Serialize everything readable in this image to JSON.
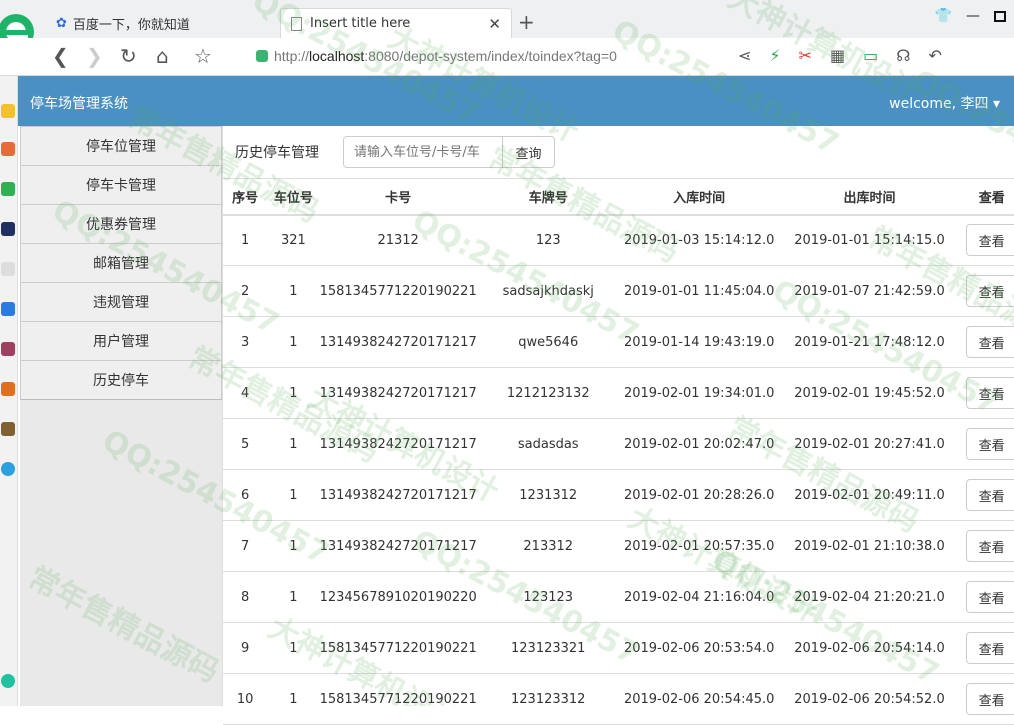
{
  "browser": {
    "tab1_title": "百度一下，你就知道",
    "tab2_title": "Insert title here",
    "url_prefix": "http://",
    "url_host": "localhost",
    "url_rest": ":8080/depot-system/index/toindex?tag=0"
  },
  "app": {
    "title": "停车场管理系统",
    "welcome": "welcome, 李四 ▾"
  },
  "menu": [
    {
      "label": "停车位管理"
    },
    {
      "label": "停车卡管理"
    },
    {
      "label": "优惠券管理"
    },
    {
      "label": "邮箱管理"
    },
    {
      "label": "违规管理"
    },
    {
      "label": "用户管理"
    },
    {
      "label": "历史停车"
    }
  ],
  "main": {
    "section_label": "历史停车管理",
    "search_placeholder": "请输入车位号/卡号/车",
    "search_button": "查询",
    "columns": [
      "序号",
      "车位号",
      "卡号",
      "车牌号",
      "入库时间",
      "出库时间",
      "查看"
    ],
    "view_label": "查看",
    "rows": [
      {
        "no": "1",
        "slot": "321",
        "card": "21312",
        "plate": "123",
        "in": "2019-01-03 15:14:12.0",
        "out": "2019-01-01 15:14:15.0"
      },
      {
        "no": "2",
        "slot": "1",
        "card": "1581345771220190221",
        "plate": "sadsajkhdaskj",
        "in": "2019-01-01 11:45:04.0",
        "out": "2019-01-07 21:42:59.0"
      },
      {
        "no": "3",
        "slot": "1",
        "card": "1314938242720171217",
        "plate": "qwe5646",
        "in": "2019-01-14 19:43:19.0",
        "out": "2019-01-21 17:48:12.0"
      },
      {
        "no": "4",
        "slot": "1",
        "card": "1314938242720171217",
        "plate": "1212123132",
        "in": "2019-02-01 19:34:01.0",
        "out": "2019-02-01 19:45:52.0"
      },
      {
        "no": "5",
        "slot": "1",
        "card": "1314938242720171217",
        "plate": "sadasdas",
        "in": "2019-02-01 20:02:47.0",
        "out": "2019-02-01 20:27:41.0"
      },
      {
        "no": "6",
        "slot": "1",
        "card": "1314938242720171217",
        "plate": "1231312",
        "in": "2019-02-01 20:28:26.0",
        "out": "2019-02-01 20:49:11.0"
      },
      {
        "no": "7",
        "slot": "1",
        "card": "1314938242720171217",
        "plate": "213312",
        "in": "2019-02-01 20:57:35.0",
        "out": "2019-02-01 21:10:38.0"
      },
      {
        "no": "8",
        "slot": "1",
        "card": "1234567891020190220",
        "plate": "123123",
        "in": "2019-02-04 21:16:04.0",
        "out": "2019-02-04 21:20:21.0"
      },
      {
        "no": "9",
        "slot": "1",
        "card": "1581345771220190221",
        "plate": "123123321",
        "in": "2019-02-06 20:53:54.0",
        "out": "2019-02-06 20:54:14.0"
      },
      {
        "no": "10",
        "slot": "1",
        "card": "1581345771220190221",
        "plate": "123123312",
        "in": "2019-02-06 20:54:45.0",
        "out": "2019-02-06 20:54:52.0"
      }
    ]
  },
  "watermark": {
    "texts": [
      "QQ:254540457",
      "常年售精品源码",
      "大神计算机设计"
    ]
  }
}
